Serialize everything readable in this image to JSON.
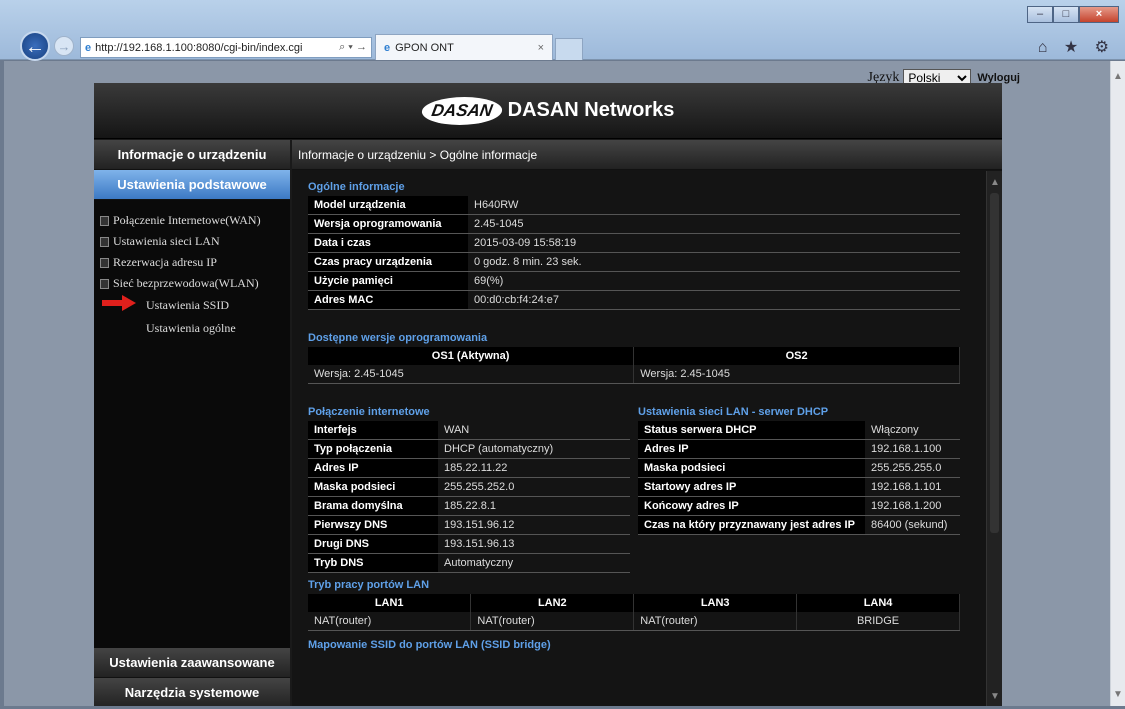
{
  "browser": {
    "url": "http://192.168.1.100:8080/cgi-bin/index.cgi",
    "url_tools": "⌕ ▾ →",
    "tab_title": "GPON ONT",
    "tab_close": "×",
    "back_glyph": "←",
    "forward_glyph": "→",
    "right_icons": "⌂ ★ ⚙"
  },
  "header": {
    "language_label": "Język",
    "language_value": "Polski",
    "logout_label": "Wyloguj",
    "logo_text": "DASAN",
    "brand": "DASAN Networks"
  },
  "sidebar": {
    "device_info": "Informacje o urządzeniu",
    "basic_settings": "Ustawienia podstawowe",
    "items": [
      {
        "label": "Połączenie Internetowe(WAN)"
      },
      {
        "label": "Ustawienia sieci LAN"
      },
      {
        "label": "Rezerwacja adresu IP"
      },
      {
        "label": "Sieć bezprzewodowa(WLAN)"
      }
    ],
    "subitems": [
      {
        "label": "Ustawienia SSID"
      },
      {
        "label": "Ustawienia ogólne"
      }
    ],
    "advanced": "Ustawienia zaawansowane",
    "tools": "Narzędzia systemowe"
  },
  "breadcrumb": "Informacje o urządzeniu > Ogólne informacje",
  "general": {
    "title": "Ogólne informacje",
    "rows": [
      {
        "k": "Model urządzenia",
        "v": "H640RW"
      },
      {
        "k": "Wersja oprogramowania",
        "v": "2.45-1045"
      },
      {
        "k": "Data i czas",
        "v": "2015-03-09 15:58:19"
      },
      {
        "k": "Czas pracy urządzenia",
        "v": "0 godz. 8 min. 23 sek."
      },
      {
        "k": "Użycie pamięci",
        "v": "69(%)"
      },
      {
        "k": "Adres MAC",
        "v": "00:d0:cb:f4:24:e7"
      }
    ]
  },
  "firmware": {
    "title": "Dostępne wersje oprogramowania",
    "os1": "OS1 (Aktywna)",
    "os2": "OS2",
    "os1_version": "Wersja: 2.45-1045",
    "os2_version": "Wersja: 2.45-1045"
  },
  "wan": {
    "title": "Połączenie internetowe",
    "rows": [
      {
        "k": "Interfejs",
        "v": "WAN"
      },
      {
        "k": "Typ połączenia",
        "v": "DHCP (automatyczny)"
      },
      {
        "k": "Adres IP",
        "v": "185.22.11.22"
      },
      {
        "k": "Maska podsieci",
        "v": "255.255.252.0"
      },
      {
        "k": "Brama domyślna",
        "v": "185.22.8.1"
      },
      {
        "k": "Pierwszy DNS",
        "v": "193.151.96.12"
      },
      {
        "k": "Drugi DNS",
        "v": "193.151.96.13"
      },
      {
        "k": "Tryb DNS",
        "v": "Automatyczny"
      }
    ]
  },
  "dhcp": {
    "title": "Ustawienia sieci LAN - serwer DHCP",
    "rows": [
      {
        "k": "Status serwera DHCP",
        "v": "Włączony"
      },
      {
        "k": "Adres IP",
        "v": "192.168.1.100"
      },
      {
        "k": "Maska podsieci",
        "v": "255.255.255.0"
      },
      {
        "k": "Startowy adres IP",
        "v": "192.168.1.101"
      },
      {
        "k": "Końcowy adres IP",
        "v": "192.168.1.200"
      },
      {
        "k": "Czas na który przyznawany jest adres IP",
        "v": "86400 (sekund)"
      }
    ]
  },
  "lan_ports": {
    "title": "Tryb pracy portów LAN",
    "headers": [
      "LAN1",
      "LAN2",
      "LAN3",
      "LAN4"
    ],
    "values": [
      "NAT(router)",
      "NAT(router)",
      "NAT(router)",
      "BRIDGE"
    ]
  },
  "ssid_map": {
    "title": "Mapowanie SSID do portów LAN (SSID bridge)"
  },
  "colors": {
    "accent_blue": "#5fa0e8",
    "active_menu": "#3c79c4",
    "arrow_red": "#e0201c"
  }
}
